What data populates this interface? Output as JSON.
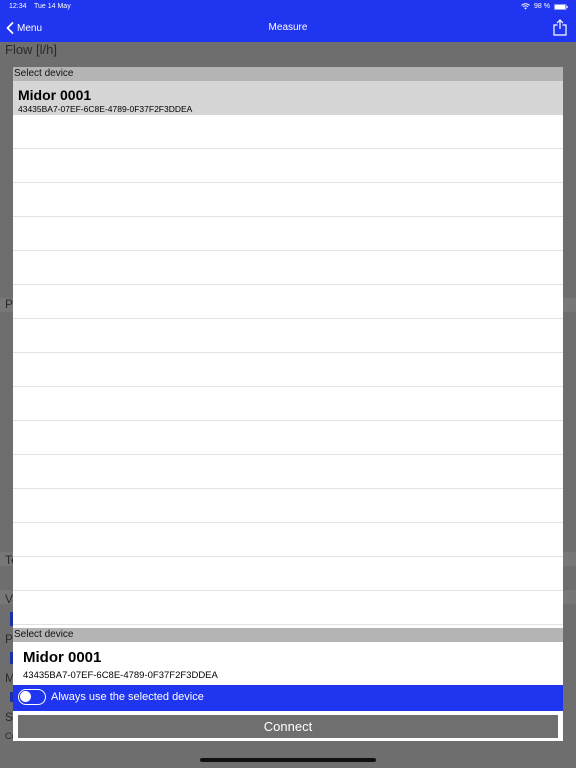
{
  "status_bar": {
    "time": "12:34",
    "date": "Tue 14 May",
    "battery": "98 %"
  },
  "nav": {
    "back_label": "Menu",
    "title": "Measure"
  },
  "background": {
    "flow_label": "Flow [l/h]",
    "fragments": [
      "P",
      "Te",
      "Va",
      "Pr",
      "M",
      "Sh",
      "Co"
    ]
  },
  "picker": {
    "section_header": "Select device",
    "devices": [
      {
        "name": "Midor 0001",
        "id": "43435BA7-07EF-6C8E-4789-0F37F2F3DDEA"
      }
    ]
  },
  "selection": {
    "section_header": "Select device",
    "device_name": "Midor 0001",
    "device_id": "43435BA7-07EF-6C8E-4789-0F37F2F3DDEA",
    "always_use_label": "Always use the selected device",
    "always_use_enabled": false,
    "connect_label": "Connect"
  },
  "colors": {
    "accent": "#1f35f0",
    "overlay": "#6e6e6e",
    "selected_row": "#d6d6d6",
    "section_header": "#b4b4b4",
    "connect_button": "#6f6f6f"
  },
  "icons": {
    "back": "chevron-left-icon",
    "share": "share-icon",
    "wifi": "wifi-icon",
    "battery": "battery-icon"
  }
}
